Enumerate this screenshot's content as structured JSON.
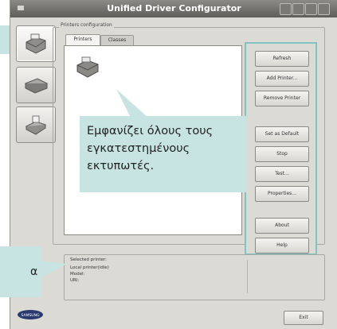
{
  "window": {
    "title": "Unified Driver Configurator"
  },
  "printers_group": {
    "label": "Printers configuration"
  },
  "tabs": [
    {
      "label": "Printers"
    },
    {
      "label": "Classes"
    }
  ],
  "buttons": {
    "refresh": "Refresh",
    "add_printer": "Add Printer...",
    "remove_printer": "Remove Printer",
    "set_default": "Set as Default",
    "stop": "Stop",
    "test": "Test...",
    "properties": "Properties...",
    "about": "About",
    "help": "Help",
    "exit": "Exit"
  },
  "callouts": {
    "main": [
      "Εμφανίζει όλους τους",
      "εγκατεστημένους",
      "εκτυπωτές."
    ],
    "left_partial": "α"
  },
  "selected_printer": {
    "label": "Selected printer:",
    "line1": "Local printer(idle)",
    "line2": "Model:",
    "line3": "URI:"
  },
  "logo": {
    "text": "SAMSUNG"
  },
  "colors": {
    "callout": "#c7e4e2",
    "highlight_border": "#7fc4c0"
  }
}
